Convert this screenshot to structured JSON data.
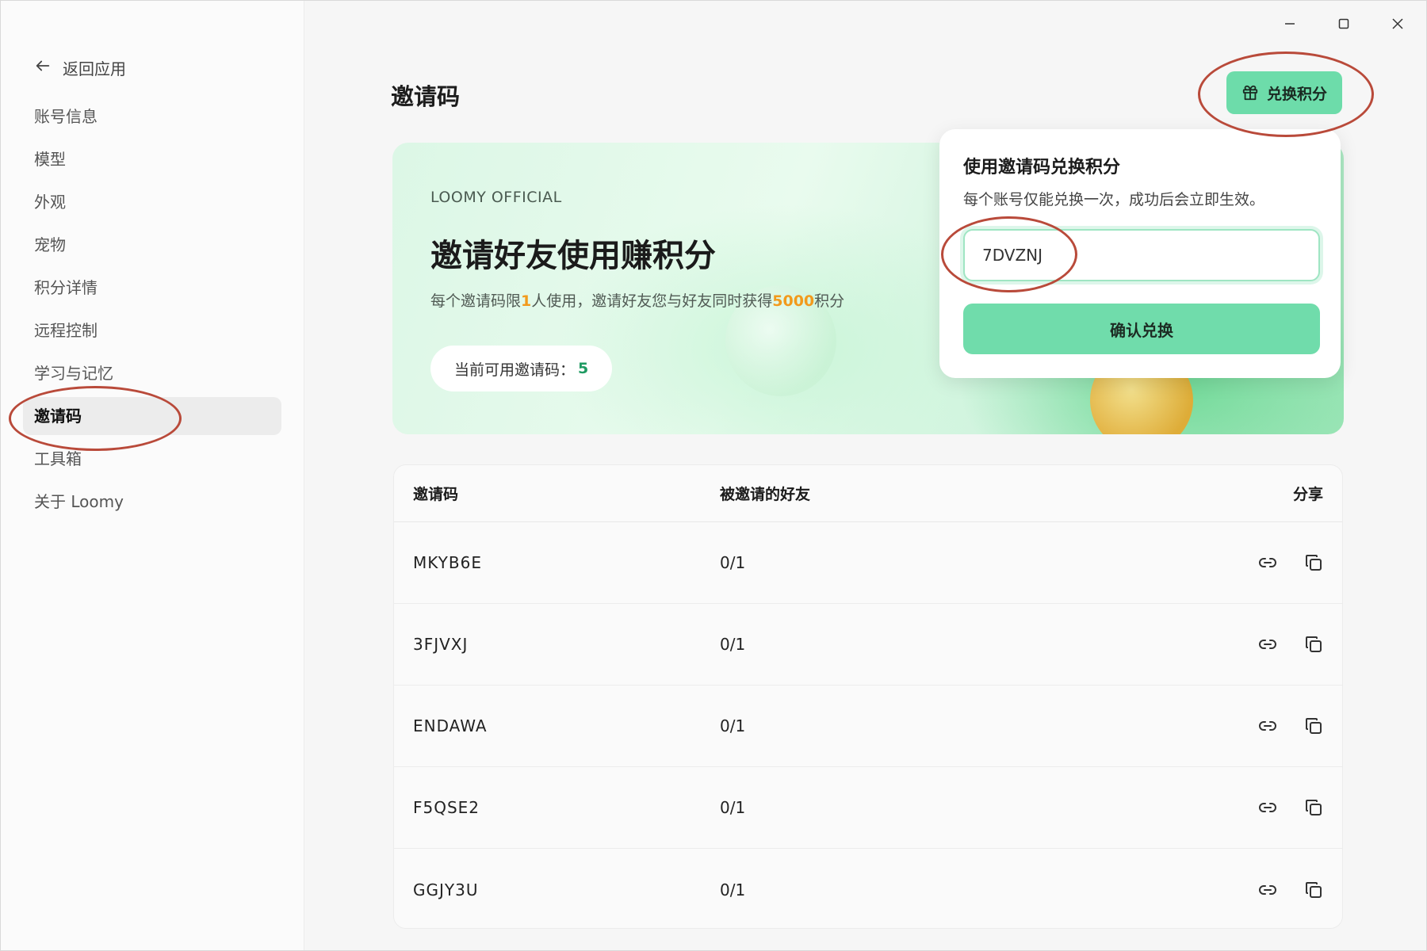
{
  "sidebar": {
    "back_label": "返回应用",
    "items": [
      {
        "label": "账号信息"
      },
      {
        "label": "模型"
      },
      {
        "label": "外观"
      },
      {
        "label": "宠物"
      },
      {
        "label": "积分详情"
      },
      {
        "label": "远程控制"
      },
      {
        "label": "学习与记忆"
      },
      {
        "label": "邀请码",
        "active": true
      },
      {
        "label": "工具箱"
      },
      {
        "label": "关于 Loomy"
      }
    ]
  },
  "header": {
    "title": "邀请码",
    "redeem_button": "兑换积分"
  },
  "banner": {
    "brand": "LOOMY OFFICIAL",
    "title": "邀请好友使用赚积分",
    "desc_part1": "每个邀请码限",
    "desc_num1": "1",
    "desc_part2": "人使用，邀请好友您与好友同时获得",
    "desc_num2": "5000",
    "desc_part3": "积分",
    "available_label": "当前可用邀请码：",
    "available_count": "5"
  },
  "popover": {
    "title": "使用邀请码兑换积分",
    "desc": "每个账号仅能兑换一次，成功后会立即生效。",
    "input_value": "7DVZNJ",
    "confirm_label": "确认兑换"
  },
  "table": {
    "headers": [
      "邀请码",
      "被邀请的好友",
      "分享"
    ],
    "rows": [
      {
        "code": "MKYB6E",
        "friends": "0/1"
      },
      {
        "code": "3FJVXJ",
        "friends": "0/1"
      },
      {
        "code": "ENDAWA",
        "friends": "0/1"
      },
      {
        "code": "F5QSE2",
        "friends": "0/1"
      },
      {
        "code": "GGJY3U",
        "friends": "0/1"
      }
    ]
  },
  "colors": {
    "accent": "#6ddcaa",
    "highlight": "#f29a1c",
    "annotation": "#b94a3a"
  }
}
